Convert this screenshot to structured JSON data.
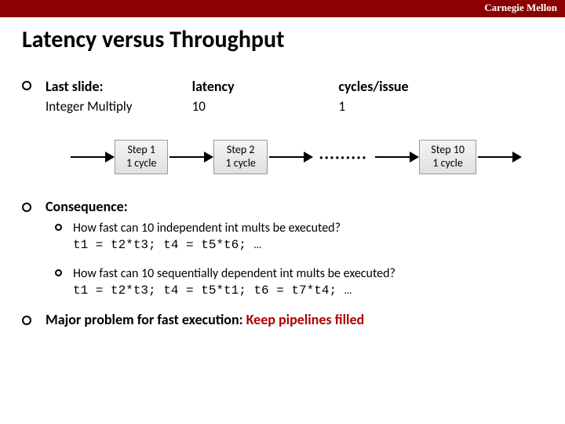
{
  "brand": "Carnegie Mellon",
  "title": "Latency versus Throughput",
  "table": {
    "h1": "Last slide:",
    "h2": "latency",
    "h3": "cycles/issue",
    "r1": "Integer Multiply",
    "r2": "10",
    "r3": "1"
  },
  "steps": {
    "s1a": "Step 1",
    "s1b": "1 cycle",
    "s2a": "Step 2",
    "s2b": "1 cycle",
    "s10a": "Step 10",
    "s10b": "1 cycle"
  },
  "consequence": "Consequence:",
  "q1": "How fast can 10 independent int mults be executed?",
  "q1code": "t1 = t2*t3; t4 = t5*t6; …",
  "q2": "How fast can 10 sequentially dependent int mults be executed?",
  "q2code": "t1 = t2*t3; t4 = t5*t1; t6 = t7*t4; …",
  "major": "Major problem for fast execution: ",
  "majorEm": "Keep pipelines filled"
}
